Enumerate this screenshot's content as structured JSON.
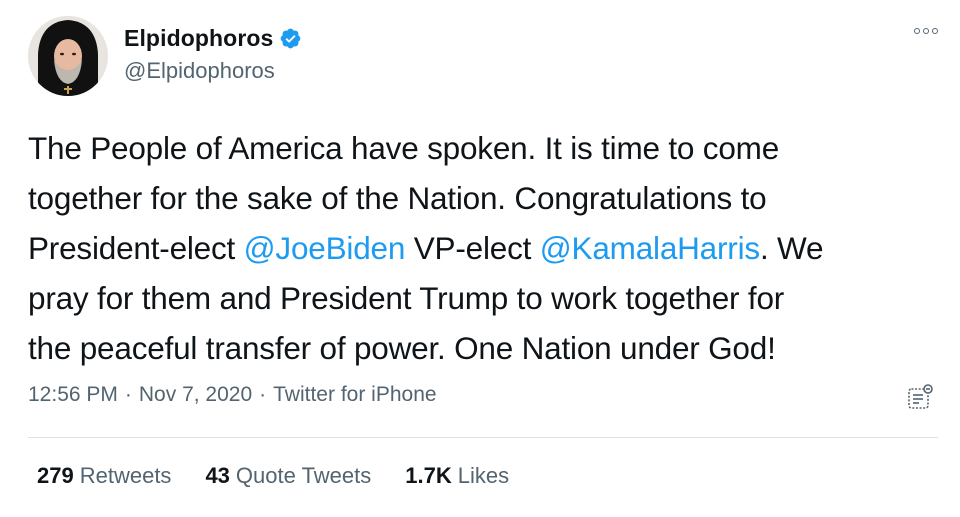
{
  "author": {
    "display_name": "Elpidophoros",
    "handle": "@Elpidophoros",
    "verified": true
  },
  "tweet": {
    "lines": [
      [
        {
          "text": "The People of America have spoken. It is time to come"
        }
      ],
      [
        {
          "text": "together for the sake of the Nation. Congratulations to"
        }
      ],
      [
        {
          "text": "President-elect "
        },
        {
          "text": "@JoeBiden",
          "mention": true
        },
        {
          "text": " VP-elect "
        },
        {
          "text": "@KamalaHarris",
          "mention": true
        },
        {
          "text": ". We"
        }
      ],
      [
        {
          "text": "pray for them and President Trump to work together for"
        }
      ],
      [
        {
          "text": "the peaceful transfer of power. One Nation under God!"
        }
      ]
    ]
  },
  "meta": {
    "time": "12:56 PM",
    "separator": "·",
    "date": "Nov 7, 2020",
    "source": "Twitter for iPhone"
  },
  "stats": [
    {
      "count": "279",
      "label": "Retweets"
    },
    {
      "count": "43",
      "label": "Quote Tweets"
    },
    {
      "count": "1.7K",
      "label": "Likes"
    }
  ],
  "colors": {
    "accent": "#1d9bf0",
    "text": "#0f1419",
    "secondary": "#536471",
    "divider": "#dbe3e8"
  },
  "icons": {
    "verified": "verified-badge-icon",
    "more": "more-options-icon",
    "analytics": "tweet-analytics-icon"
  }
}
